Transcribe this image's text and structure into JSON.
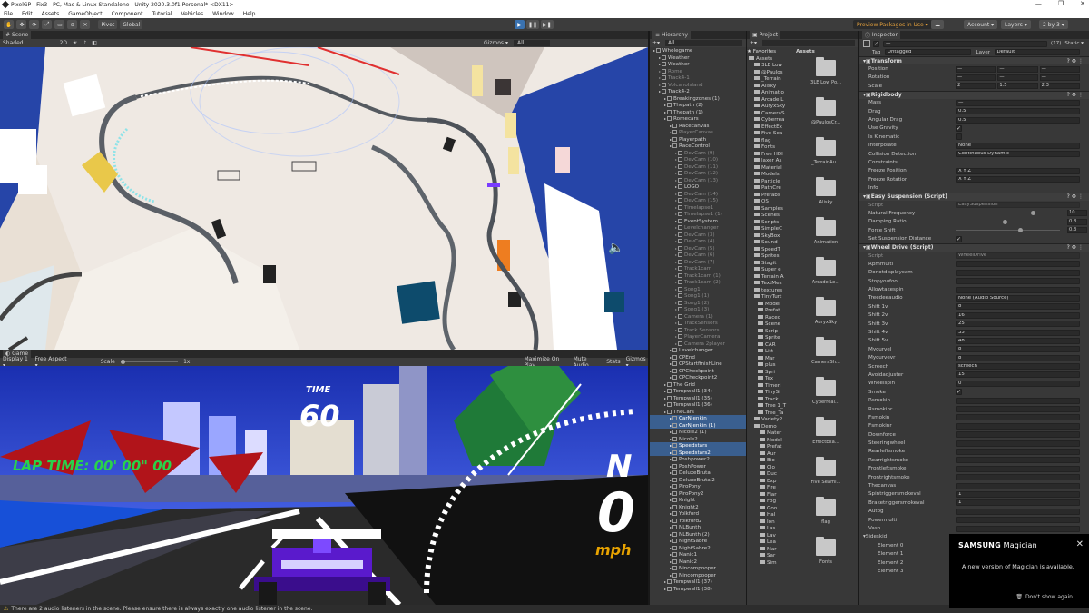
{
  "window": {
    "title": "PixelGP - Fix3 - PC, Mac & Linux Standalone - Unity 2020.3.0f1 Personal* <DX11>",
    "controls": [
      "—",
      "❐",
      "✕"
    ]
  },
  "menu": [
    "File",
    "Edit",
    "Assets",
    "GameObject",
    "Component",
    "Tutorial",
    "Vehicles",
    "Window",
    "Help"
  ],
  "toolbar": {
    "pivot": "Pivot",
    "global": "Global",
    "preview_packages": "Preview Packages in Use ▾",
    "account": "Account ▾",
    "layers": "Layers ▾",
    "layout": "2 by 3 ▾",
    "play": "▶",
    "pause": "❚❚",
    "step": "▶❚"
  },
  "scene": {
    "tab": "Scene",
    "shading": "Shaded",
    "mode": "2D",
    "gizmos": "Gizmos ▾",
    "search": "All"
  },
  "game": {
    "tab": "Game",
    "display": "Display 1 ▾",
    "aspect": "Free Aspect ▾",
    "scale_label": "Scale",
    "scale_value": "1x",
    "maximize": "Maximize On Play",
    "mute": "Mute Audio",
    "stats": "Stats",
    "gizmos": "Gizmos ▾",
    "hud_time_label": "TIME",
    "hud_time_value": "60",
    "hud_lap": "LAP TIME: 00' 00\" 00",
    "hud_speed": "0",
    "hud_gear": "N",
    "hud_unit": "mph"
  },
  "hierarchy": {
    "tab": "Hierarchy",
    "search": "All",
    "items": [
      {
        "t": "Wholegame",
        "i": 0,
        "d": false
      },
      {
        "t": "Weather",
        "i": 1,
        "d": false
      },
      {
        "t": "Weather",
        "i": 1,
        "d": false
      },
      {
        "t": "Rome",
        "i": 1,
        "d": true
      },
      {
        "t": "Track4-1",
        "i": 1,
        "d": true
      },
      {
        "t": "VolcanoIsland",
        "i": 1,
        "d": true
      },
      {
        "t": "Track4-2",
        "i": 1,
        "d": false
      },
      {
        "t": "Breakingzones (1)",
        "i": 2,
        "d": false
      },
      {
        "t": "Thepath (2)",
        "i": 2,
        "d": false
      },
      {
        "t": "Thepath (1)",
        "i": 2,
        "d": false
      },
      {
        "t": "Romecars",
        "i": 2,
        "d": false
      },
      {
        "t": "Racecanvas",
        "i": 3,
        "d": false
      },
      {
        "t": "PlayerCanvas",
        "i": 3,
        "d": true
      },
      {
        "t": "Playerpath",
        "i": 3,
        "d": false
      },
      {
        "t": "RaceControl",
        "i": 3,
        "d": false
      },
      {
        "t": "DevCam (9)",
        "i": 4,
        "d": true
      },
      {
        "t": "DevCam (10)",
        "i": 4,
        "d": true
      },
      {
        "t": "DevCam (11)",
        "i": 4,
        "d": true
      },
      {
        "t": "DevCam (12)",
        "i": 4,
        "d": true
      },
      {
        "t": "DevCam (13)",
        "i": 4,
        "d": true
      },
      {
        "t": "LOGO",
        "i": 4,
        "d": false
      },
      {
        "t": "DevCam (14)",
        "i": 4,
        "d": true
      },
      {
        "t": "DevCam (15)",
        "i": 4,
        "d": true
      },
      {
        "t": "Timelapse1",
        "i": 4,
        "d": true
      },
      {
        "t": "Timelapse1 (1)",
        "i": 4,
        "d": true
      },
      {
        "t": "EventSystem",
        "i": 4,
        "d": false
      },
      {
        "t": "Levelchanger",
        "i": 4,
        "d": true
      },
      {
        "t": "DevCam (3)",
        "i": 4,
        "d": true
      },
      {
        "t": "DevCam (4)",
        "i": 4,
        "d": true
      },
      {
        "t": "DevCam (5)",
        "i": 4,
        "d": true
      },
      {
        "t": "DevCam (6)",
        "i": 4,
        "d": true
      },
      {
        "t": "DevCam (7)",
        "i": 4,
        "d": true
      },
      {
        "t": "Track1cam",
        "i": 4,
        "d": true
      },
      {
        "t": "Track1cam (1)",
        "i": 4,
        "d": true
      },
      {
        "t": "Track1cam (2)",
        "i": 4,
        "d": true
      },
      {
        "t": "Song1",
        "i": 4,
        "d": true
      },
      {
        "t": "Song1 (1)",
        "i": 4,
        "d": true
      },
      {
        "t": "Song1 (2)",
        "i": 4,
        "d": true
      },
      {
        "t": "Song1 (3)",
        "i": 4,
        "d": true
      },
      {
        "t": "Camera (1)",
        "i": 4,
        "d": true
      },
      {
        "t": "TrackSensors",
        "i": 4,
        "d": true
      },
      {
        "t": "Track Sensors",
        "i": 4,
        "d": true
      },
      {
        "t": "PlayerCamera",
        "i": 4,
        "d": true
      },
      {
        "t": "Camera 2player",
        "i": 4,
        "d": true
      },
      {
        "t": "Levelchanger",
        "i": 3,
        "d": false
      },
      {
        "t": "CPEnd",
        "i": 3,
        "d": false
      },
      {
        "t": "CPStartfinishLine",
        "i": 3,
        "d": false
      },
      {
        "t": "CPCheckpoint",
        "i": 3,
        "d": false
      },
      {
        "t": "CPCheckpoint2",
        "i": 3,
        "d": false
      },
      {
        "t": "The Grid",
        "i": 2,
        "d": false
      },
      {
        "t": "Tempwall1 (34)",
        "i": 2,
        "d": false
      },
      {
        "t": "Tempwall1 (35)",
        "i": 2,
        "d": false
      },
      {
        "t": "Tempwall1 (36)",
        "i": 2,
        "d": false
      },
      {
        "t": "TheCars",
        "i": 2,
        "d": false
      },
      {
        "t": "CarNJenkin",
        "i": 3,
        "d": false
      },
      {
        "t": "CarNJenkin (1)",
        "i": 3,
        "d": false
      },
      {
        "t": "Nicole2 (1)",
        "i": 3,
        "d": false
      },
      {
        "t": "Nicole2",
        "i": 3,
        "d": false
      },
      {
        "t": "Speedstars",
        "i": 3,
        "d": false
      },
      {
        "t": "Speedstars2",
        "i": 3,
        "d": false
      },
      {
        "t": "Poshpower2",
        "i": 3,
        "d": false
      },
      {
        "t": "PoshPower",
        "i": 3,
        "d": false
      },
      {
        "t": "DeluxeBrutal",
        "i": 3,
        "d": false
      },
      {
        "t": "DeluxeBrutal2",
        "i": 3,
        "d": false
      },
      {
        "t": "PiroPony",
        "i": 3,
        "d": false
      },
      {
        "t": "PiroPony2",
        "i": 3,
        "d": false
      },
      {
        "t": "Knight",
        "i": 3,
        "d": false
      },
      {
        "t": "Knight2",
        "i": 3,
        "d": false
      },
      {
        "t": "Yolkford",
        "i": 3,
        "d": false
      },
      {
        "t": "Yolkford2",
        "i": 3,
        "d": false
      },
      {
        "t": "NLBunth",
        "i": 3,
        "d": false
      },
      {
        "t": "NLBunth (2)",
        "i": 3,
        "d": false
      },
      {
        "t": "NightSabre",
        "i": 3,
        "d": false
      },
      {
        "t": "NightSabre2",
        "i": 3,
        "d": false
      },
      {
        "t": "Manic1",
        "i": 3,
        "d": false
      },
      {
        "t": "Manic2",
        "i": 3,
        "d": false
      },
      {
        "t": "Nincompooper",
        "i": 3,
        "d": false
      },
      {
        "t": "Nincompooper",
        "i": 3,
        "d": false
      },
      {
        "t": "Tempwall1 (37)",
        "i": 2,
        "d": false
      },
      {
        "t": "Tempwall1 (38)",
        "i": 2,
        "d": false
      }
    ]
  },
  "project": {
    "tab": "Project",
    "favorites": "★ Favorites",
    "assets_header": "Assets",
    "tree": [
      "Assets",
      "3LE Low",
      "@Paulos",
      "_Terrain",
      "Alisky",
      "Animatio",
      "Arcade L",
      "AuryxSky",
      "CameraS",
      "Cyberrea",
      "EffectEx",
      "Five Sea",
      "flag",
      "Fonts",
      "Free HDI",
      "laxer As",
      "Material",
      "Models",
      "Particle",
      "PathCre",
      "Prefabs",
      "QS",
      "Samples",
      "Scenes",
      "Scripts",
      "SimpleC",
      "SkyBox",
      "Sound",
      "SpeedT",
      "Sprites",
      "Stagit",
      "Super e",
      "Terrain A",
      "TextMes",
      "textures",
      "TinyTurt",
      "Model",
      "Prefat",
      "Racec",
      "Scene",
      "Scrip",
      "Sprite",
      "CAR",
      "Litt",
      "Mar",
      "plus",
      "Spri",
      "Tex",
      "Timeri",
      "TinySi",
      "Track",
      "Tree 1_T",
      "Tree_Ta",
      "VarietyP",
      "Demo",
      "Mater",
      "Model",
      "Prefat",
      "Aur",
      "Bio",
      "Clo",
      "Duc",
      "Exp",
      "Fire",
      "Flar",
      "Fog",
      "Goo",
      "Hal",
      "Ion",
      "Las",
      "Lav",
      "Lea",
      "Mar",
      "Sar",
      "Sim"
    ],
    "grid": [
      "3LE Low Po...",
      "@PaulosCr...",
      "_TerrainAu...",
      "Alisky",
      "Animation",
      "Arcade Le...",
      "AuryxSky",
      "CameraSh...",
      "Cyberreal...",
      "EffectExa...",
      "Five Seaml...",
      "flag",
      "Fonts"
    ]
  },
  "inspector": {
    "tab": "Inspector",
    "name": "—",
    "static": "Static ▾",
    "tag_label": "Tag",
    "tag": "Untagged",
    "layer_label": "Layer",
    "layer": "Default",
    "count": "(17)",
    "transform": {
      "title": "Transform",
      "rows": [
        {
          "l": "Position",
          "x": "—",
          "y": "—",
          "z": "—"
        },
        {
          "l": "Rotation",
          "x": "—",
          "y": "—",
          "z": "—"
        },
        {
          "l": "Scale",
          "x": "2",
          "y": "1.5",
          "z": "2.3"
        }
      ]
    },
    "rigidbody": {
      "title": "Rigidbody",
      "rows": [
        {
          "l": "Mass",
          "v": "—"
        },
        {
          "l": "Drag",
          "v": "0.5"
        },
        {
          "l": "Angular Drag",
          "v": "0.5"
        },
        {
          "l": "Use Gravity",
          "c": "✓"
        },
        {
          "l": "Is Kinematic",
          "c": ""
        },
        {
          "l": "Interpolate",
          "v": "None"
        },
        {
          "l": "Collision Detection",
          "v": "Continuous Dynamic"
        },
        {
          "l": "Constraints",
          "v": ""
        },
        {
          "l": "Freeze Position",
          "v": "X  Y  Z"
        },
        {
          "l": "Freeze Rotation",
          "v": "X  Y  Z"
        },
        {
          "l": "Info",
          "v": ""
        }
      ]
    },
    "suspension": {
      "title": "Easy Suspension (Script)",
      "script": "EasySuspension",
      "rows": [
        {
          "l": "Natural Frequency",
          "s": 0.72,
          "n": "10"
        },
        {
          "l": "Damping Ratio",
          "s": 0.45,
          "n": "0.8"
        },
        {
          "l": "Force Shift",
          "s": 0.6,
          "n": "0.3"
        }
      ],
      "set_label": "Set Suspension Distance",
      "set": "✓"
    },
    "wheeldrive": {
      "title": "Wheel Drive (Script)",
      "script": "WheelDrive",
      "rows": [
        {
          "l": "Rpmmulti",
          "v": ""
        },
        {
          "l": "Donotdisplaycam",
          "v": "—"
        },
        {
          "l": "Stopyoufool",
          "v": ""
        },
        {
          "l": "Allowtakespin",
          "v": ""
        },
        {
          "l": "Treedeeaudio",
          "v": "None (Audio Source)"
        },
        {
          "l": "Shift 1v",
          "v": "8"
        },
        {
          "l": "Shift 2v",
          "v": "16"
        },
        {
          "l": "Shift 3v",
          "v": "25"
        },
        {
          "l": "Shift 4v",
          "v": "35"
        },
        {
          "l": "Shift 5v",
          "v": "48"
        },
        {
          "l": "Mycurvel",
          "v": "8"
        },
        {
          "l": "Mycurvevr",
          "v": "8"
        },
        {
          "l": "Screech",
          "v": "screech"
        },
        {
          "l": "Avoidadjuster",
          "v": "15"
        },
        {
          "l": "Wheelspin",
          "v": "0"
        },
        {
          "l": "Smoke",
          "v": "✓"
        },
        {
          "l": "Rsmokin",
          "v": ""
        },
        {
          "l": "Rsmokinr",
          "v": ""
        },
        {
          "l": "Fsmokin",
          "v": ""
        },
        {
          "l": "Fsmokinr",
          "v": ""
        },
        {
          "l": "Downforce",
          "v": ""
        },
        {
          "l": "Steeringwheel",
          "v": ""
        },
        {
          "l": "Rearleftsmoke",
          "v": ""
        },
        {
          "l": "Rearrightsmoke",
          "v": ""
        },
        {
          "l": "Frontleftsmoke",
          "v": ""
        },
        {
          "l": "Frontrightsmoke",
          "v": ""
        },
        {
          "l": "Thecanvas",
          "v": ""
        },
        {
          "l": "Spintriggersmokeval",
          "v": "1"
        },
        {
          "l": "Braketriggersmokeval",
          "v": "1"
        },
        {
          "l": "Autog",
          "v": ""
        },
        {
          "l": "Powermulti",
          "v": ""
        },
        {
          "l": "Vaso",
          "v": ""
        }
      ]
    },
    "sideskid": {
      "title": "Sideskid",
      "items": [
        "Element 0",
        "Element 1",
        "Element 2",
        "Element 3"
      ]
    }
  },
  "status": "There are 2 audio listeners in the scene. Please ensure there is always exactly one audio listener in the scene.",
  "popup": {
    "brand": "SAMSUNG",
    "title": "Magician",
    "body": "A new version of Magician is available.",
    "dismiss": "Don't show again",
    "close": "✕"
  }
}
